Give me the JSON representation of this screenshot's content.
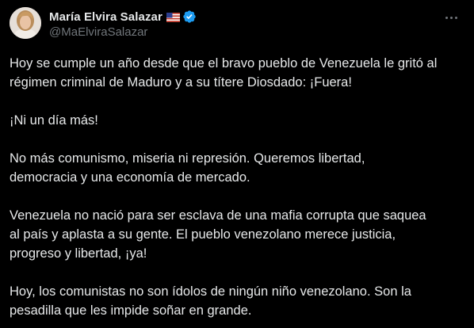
{
  "tweet": {
    "author": {
      "display_name": "María Elvira Salazar",
      "handle": "@MaElviraSalazar",
      "flag_icon": "us-flag-icon",
      "verified_icon": "verified-badge-icon",
      "verified_color": "#1d9bf0"
    },
    "more_icon": "more-options-icon",
    "paragraphs": [
      "Hoy se cumple un año desde que el bravo pueblo de Venezuela le gritó al\nrégimen criminal de Maduro y a su títere Diosdado: ¡Fuera!",
      "¡Ni un día más!",
      "No más comunismo, miseria ni represión. Queremos libertad,\ndemocracia y una economía de mercado.",
      "Venezuela no nació para ser esclava de una mafia corrupta que saquea\nal país y aplasta a su gente. El pueblo venezolano merece justicia,\nprogreso y libertad, ¡ya!",
      "Hoy, los comunistas no son ídolos de ningún niño venezolano. Son la\npesadilla que les impide soñar en grande."
    ]
  },
  "theme": {
    "background": "#000000",
    "text": "#e7e9ea",
    "secondary_text": "#71767b"
  }
}
